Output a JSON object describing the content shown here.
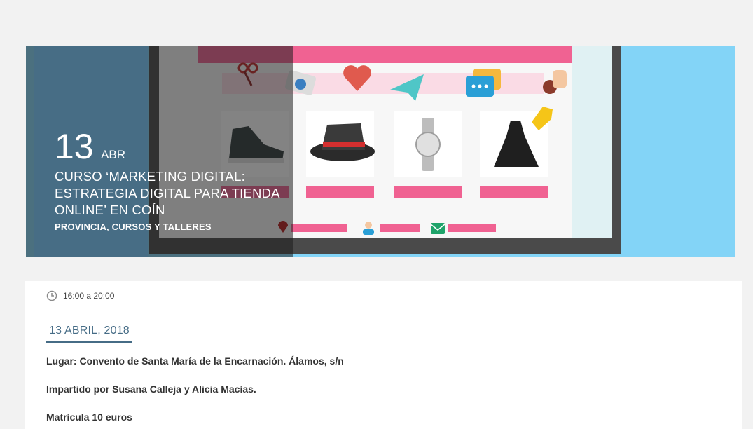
{
  "hero": {
    "day": "13",
    "month": "ABR",
    "title": "CURSO ‘MARKETING DIGITAL: ESTRATEGIA DIGITAL PARA TIENDA ONLINE’ EN COÍN",
    "categories": "PROVINCIA, CURSOS Y TALLERES"
  },
  "details": {
    "time": "16:00 a 20:00",
    "date": "13 ABRIL, 2018",
    "location": "Lugar: Convento de Santa María de la Encarnación. Álamos, s/n",
    "instructors": "Impartido por Susana Calleja y Alicia Macías.",
    "fee": "Matrícula 10 euros"
  },
  "colors": {
    "accent": "#466c86",
    "hero_bg": "#83d4f7",
    "banner_pink": "#f06292"
  },
  "icons": [
    "clock-icon",
    "location-pin-icon",
    "user-icon",
    "mail-icon",
    "scissors-icon",
    "camera-icon",
    "heart-icon",
    "paper-plane-icon",
    "chat-icon",
    "thumbs-up-icon",
    "price-tag-icon"
  ]
}
